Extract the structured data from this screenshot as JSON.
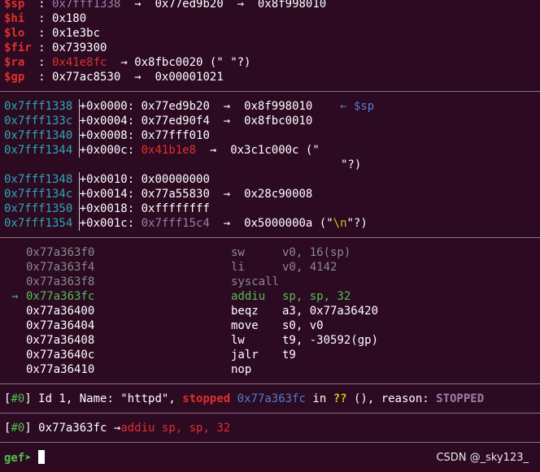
{
  "registers": [
    {
      "name": "$sp",
      "value": "0x7fff1338",
      "arrow1": "→",
      "p1": "0x77ed9b20",
      "arrow2": "→",
      "p2": "0x8f998010"
    },
    {
      "name": "$hi",
      "value": "0x180"
    },
    {
      "name": "$lo",
      "value": "0x1e3bc"
    },
    {
      "name": "$fir",
      "value": "0x739300"
    },
    {
      "name": "$ra",
      "value": "0x41e8fc",
      "arrow1": "→",
      "p1": "0x8fbc0020",
      "tail": " (\" \"?)"
    },
    {
      "name": "$gp",
      "value": "0x77ac8530",
      "arrow1": "→",
      "p1": "0x00001021"
    }
  ],
  "stack": [
    {
      "addr": "0x7fff1338",
      "off": "+0x0000:",
      "val": "0x77ed9b20",
      "arrow": "→",
      "ptr": "0x8f998010",
      "marker": "← $sp"
    },
    {
      "addr": "0x7fff133c",
      "off": "+0x0004:",
      "val": "0x77ed90f4",
      "arrow": "→",
      "ptr": "0x8fbc0010"
    },
    {
      "addr": "0x7fff1340",
      "off": "+0x0008:",
      "val": "0x77fff010"
    },
    {
      "addr": "0x7fff1344",
      "off": "+0x000c:",
      "val": "0x41b1e8",
      "arrow": "→",
      "ptr": "0x3c1c000c (\"",
      "cont": "\"?)"
    },
    {
      "addr": "0x7fff1348",
      "off": "+0x0010:",
      "val": "0x00000000"
    },
    {
      "addr": "0x7fff134c",
      "off": "+0x0014:",
      "val": "0x77a55830",
      "arrow": "→",
      "ptr": "0x28c90008"
    },
    {
      "addr": "0x7fff1350",
      "off": "+0x0018:",
      "val": "0xffffffff"
    },
    {
      "addr": "0x7fff1354",
      "off": "+0x001c:",
      "val": "0x7fff15c4",
      "arrow": "→",
      "ptr": "0x5000000a (\"",
      "esc": "\\n",
      "tail": "\"?)"
    }
  ],
  "code": [
    {
      "addr": "0x77a363f0",
      "mn": "sw",
      "ops": "v0, 16(sp)"
    },
    {
      "addr": "0x77a363f4",
      "mn": "li",
      "ops": "v0, 4142"
    },
    {
      "addr": "0x77a363f8",
      "mn": "syscall",
      "ops": ""
    },
    {
      "addr": "0x77a363fc",
      "mn": "addiu",
      "ops": "sp, sp, 32",
      "current": "→"
    },
    {
      "addr": "0x77a36400",
      "mn": "beqz",
      "ops": "a3, 0x77a36420"
    },
    {
      "addr": "0x77a36404",
      "mn": "move",
      "ops": "s0, v0"
    },
    {
      "addr": "0x77a36408",
      "mn": "lw",
      "ops": "t9, -30592(gp)"
    },
    {
      "addr": "0x77a3640c",
      "mn": "jalr",
      "ops": "t9"
    },
    {
      "addr": "0x77a36410",
      "mn": "nop",
      "ops": ""
    }
  ],
  "thread": {
    "idx": "#0",
    "id_text": "Id 1, Name: ",
    "name": "\"httpd\"",
    "comma": ",",
    "status": "stopped",
    "pc": "0x77a363fc",
    "in": "in",
    "func": "??",
    "rest": "(), reason:",
    "reason": "STOPPED"
  },
  "trace": {
    "idx": "#0",
    "addr": "0x77a363fc",
    "arrow": "→",
    "insn": "addiu sp, sp, 32"
  },
  "prompt": {
    "text": "gef➤"
  },
  "watermark": "CSDN @_sky123_",
  "colors": {
    "bg": "#2c0a22",
    "register": "#e0302a",
    "address": "#2fa7b5",
    "current": "#52c04e"
  }
}
